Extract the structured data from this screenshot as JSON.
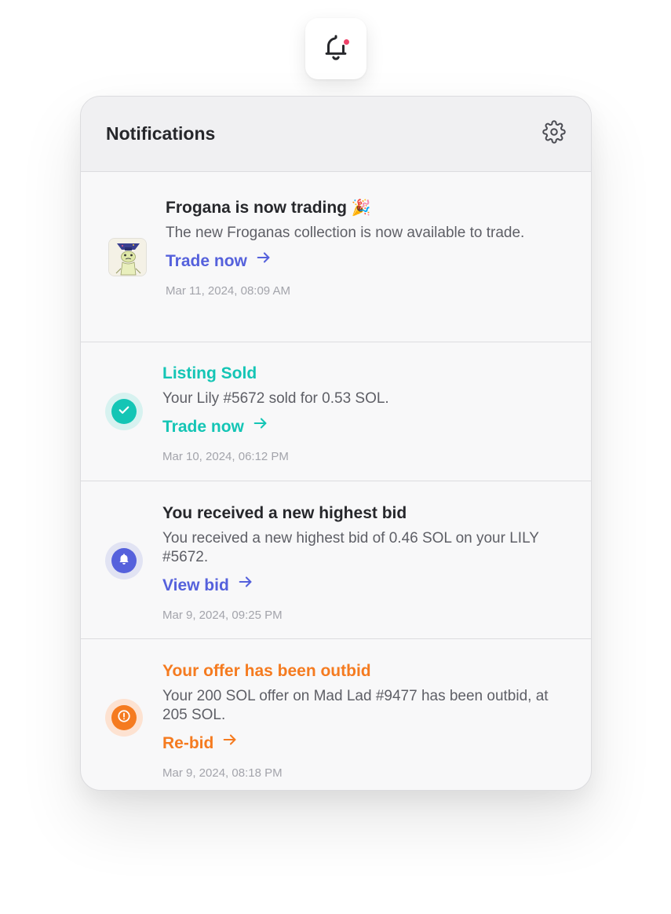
{
  "trigger": {
    "icon": "bell-icon",
    "has_unread": true,
    "dot_color": "#f0436a"
  },
  "panel": {
    "title": "Notifications",
    "settings_icon": "gear-icon"
  },
  "colors": {
    "heading": "#26272b",
    "teal": "#14c5b5",
    "blue": "#5561dc",
    "orange": "#f57b20",
    "muted": "#a3a4ab"
  },
  "notifications": [
    {
      "icon": "collection-thumbnail",
      "title": "Frogana is now trading",
      "title_emoji": "🎉",
      "body": "The new Froganas collection is now available to trade.",
      "action": "Trade now",
      "time": "Mar 11, 2024, 08:09 AM"
    },
    {
      "icon": "check-icon",
      "title": "Listing Sold",
      "body": "Your Lily #5672 sold for 0.53 SOL.",
      "action": "Trade now",
      "time": "Mar 10, 2024, 06:12 PM"
    },
    {
      "icon": "bell-icon",
      "title": "You received a new highest bid",
      "body": "You received a new highest bid of 0.46 SOL on your LILY #5672.",
      "action": "View bid",
      "time": "Mar 9, 2024, 09:25 PM"
    },
    {
      "icon": "alert-icon",
      "title": "Your offer has been outbid",
      "body": "Your 200 SOL offer on Mad Lad #9477 has been outbid, at 205 SOL.",
      "action": "Re-bid",
      "time": "Mar 9, 2024, 08:18 PM"
    }
  ]
}
